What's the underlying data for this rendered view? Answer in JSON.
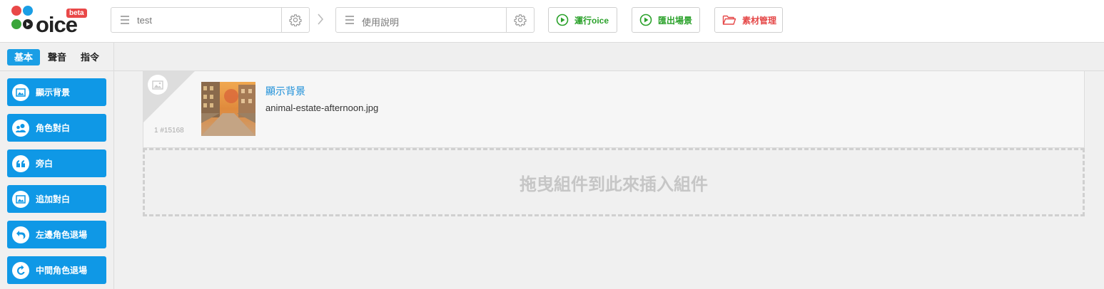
{
  "logo": {
    "word": "oice",
    "badge": "beta"
  },
  "breadcrumb": {
    "story": {
      "label": "test"
    },
    "episode": {
      "label": "使用說明"
    }
  },
  "toolbar": {
    "run": "運行oice",
    "export": "匯出場景",
    "assets": "素材管理"
  },
  "left_tabs": [
    "基本",
    "聲音",
    "指令"
  ],
  "components": [
    {
      "label": "顯示背景",
      "icon": "image-icon"
    },
    {
      "label": "角色對白",
      "icon": "characters-icon"
    },
    {
      "label": "旁白",
      "icon": "quote-icon"
    },
    {
      "label": "追加對白",
      "icon": "image-icon"
    },
    {
      "label": "左邊角色退場",
      "icon": "undo-arrow-icon"
    },
    {
      "label": "中間角色退場",
      "icon": "rotate-arrow-icon"
    }
  ],
  "block": {
    "title": "顯示背景",
    "filename": "animal-estate-afternoon.jpg",
    "id": "1 #15168"
  },
  "dropzone": {
    "text": "拖曳組件到此來插入組件"
  },
  "colors": {
    "accent": "#0f98e6",
    "run_green": "#2aa12a",
    "assets_red": "#e54848",
    "link_blue": "#1a8ed8"
  }
}
